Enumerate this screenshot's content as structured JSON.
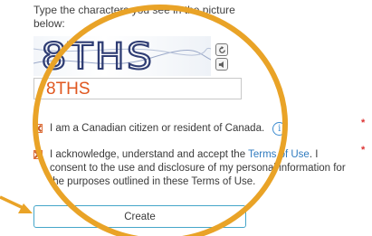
{
  "form": {
    "instructions": "Type the characters you see in the picture below:",
    "captcha": {
      "image_text": "8THS",
      "entered_value": "8THS",
      "refresh_icon": "refresh-icon",
      "audio_icon": "audio-icon"
    },
    "citizen_checkbox": {
      "checked": true,
      "label": "I am a Canadian citizen or resident of Canada.",
      "info_symbol": "i"
    },
    "terms_checkbox": {
      "checked": true,
      "text_before": "I acknowledge, understand and accept the ",
      "link_text": "Terms of Use",
      "text_after": ". I consent to the use and disclosure of my personal information for the purposes outlined in these Terms of Use."
    },
    "required_marker": "*",
    "create_button_label": "Create"
  },
  "annotations": {
    "highlight_color": "#e9a327",
    "arrow_color": "#e9a327"
  }
}
